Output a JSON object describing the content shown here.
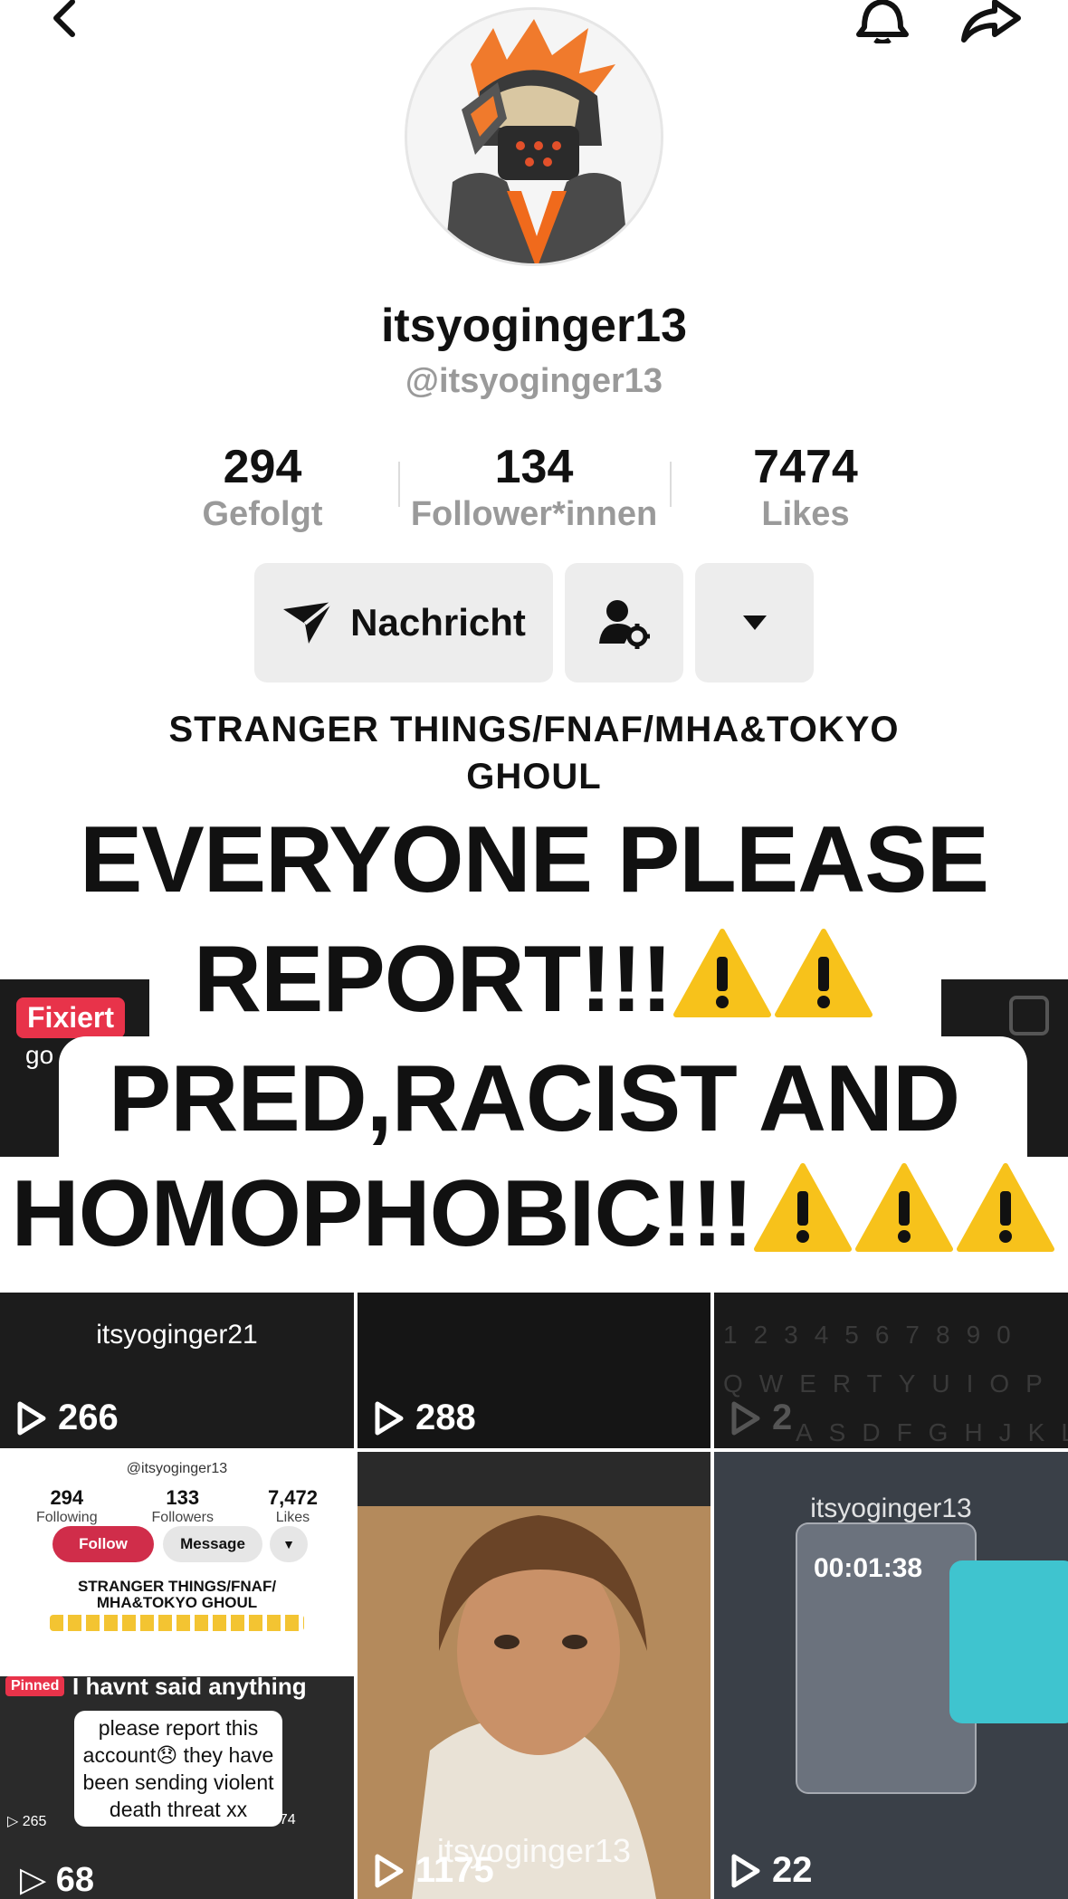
{
  "profile": {
    "display_name": "itsyoginger13",
    "handle": "@itsyoginger13",
    "stats": [
      {
        "value": "294",
        "label": "Gefolgt"
      },
      {
        "value": "134",
        "label": "Follower*innen"
      },
      {
        "value": "7474",
        "label": "Likes"
      }
    ],
    "message_label": "Nachricht",
    "bio": "STRANGER THINGS/FNAF/MHA&TOKYO GHOUL"
  },
  "pinned": {
    "badge": "Fixiert",
    "caption_snippet": "go",
    "headline_lines": [
      "EVERYONE PLEASE",
      "REPORT!!!",
      "PRED,RACIST AND",
      "HOMOPHOBIC!!!"
    ]
  },
  "videos": [
    {
      "title": "itsyoginger21",
      "views": "266"
    },
    {
      "views": "288"
    },
    {
      "keys_row1": "1234567890",
      "keys_row2": "QWERTYUIOP",
      "keys_row3": "ASDFGHJKL",
      "views": "2"
    },
    {
      "mini_handle": "@itsyoginger13",
      "mini_stats": [
        {
          "value": "294",
          "label": "Following"
        },
        {
          "value": "133",
          "label": "Followers"
        },
        {
          "value": "7,472",
          "label": "Likes"
        }
      ],
      "mini_follow": "Follow",
      "mini_message": "Message",
      "mini_bio": "STRANGER THINGS/FNAF/ MHA&TOKYO GHOUL",
      "mini_pinned": "Pinned",
      "mini_said": "I havnt said anything",
      "mini_bubble": "please report this account😞 they have been sending violent death threat xx",
      "mini_views_a": "▷ 265",
      "mini_views_b": "174",
      "views": "68"
    },
    {
      "watermark": "itsyoginger13",
      "views": "1175"
    },
    {
      "watermark": "itsyoginger13",
      "timer": "00:01:38",
      "views": "22"
    }
  ]
}
